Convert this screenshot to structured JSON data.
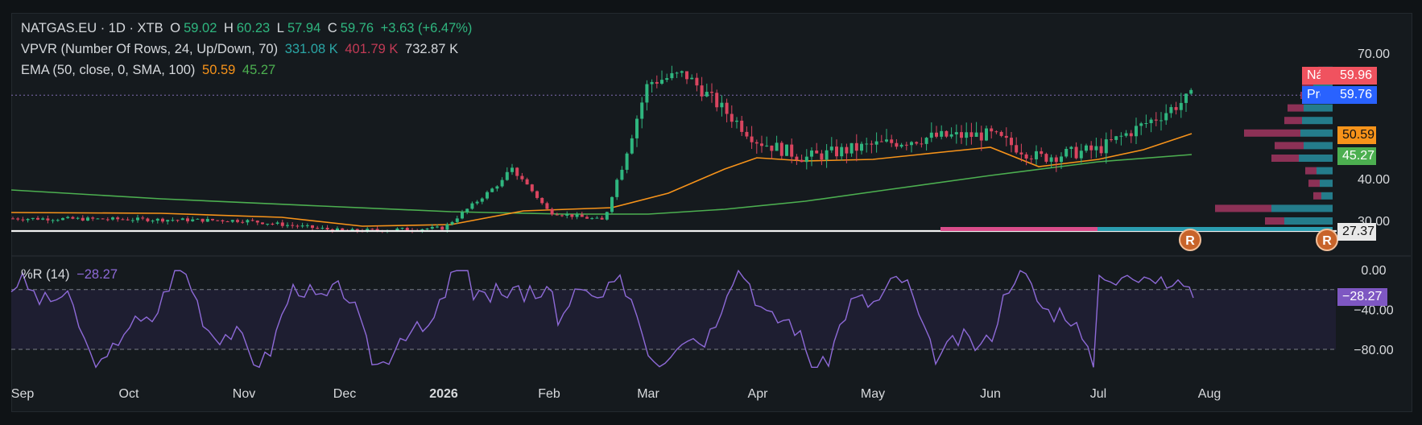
{
  "header": {
    "symbol": "NATGAS.EU · 1D · XTB",
    "o_label": "O",
    "o_value": "59.02",
    "h_label": "H",
    "h_value": "60.23",
    "l_label": "L",
    "l_value": "57.94",
    "c_label": "C",
    "c_value": "59.76",
    "change": "+3.63 (+6.47%)"
  },
  "vpvr": {
    "label": "VPVR (Number Of Rows, 24, Up/Down, 70)",
    "up": "331.08 K",
    "down": "401.79 K",
    "total": "732.87 K"
  },
  "ema": {
    "label": "EMA (50, close, 0, SMA, 100)",
    "v1": "50.59",
    "v2": "45.27"
  },
  "wr": {
    "label": "%R (14)",
    "value": "−28.27"
  },
  "badges": {
    "buy_label": "Nákup",
    "buy_value": "59.96",
    "sell_label": "Prodej",
    "sell_value": "59.76",
    "ema50": "50.59",
    "ema100": "45.27",
    "hline": "27.37",
    "wr": "−28.27"
  },
  "colors": {
    "up": "#2fb67f",
    "down": "#d9455f",
    "ema50": "#f7931a",
    "ema100": "#4caf50",
    "wr": "#8e6ad8",
    "buy": "#f0525f",
    "sell": "#2962ff"
  },
  "chart_data": [
    {
      "type": "candlestick",
      "x_tick_labels": [
        "Sep",
        "Oct",
        "Nov",
        "Dec",
        "2026",
        "Feb",
        "Mar",
        "Apr",
        "May",
        "Jun",
        "Jul",
        "Aug"
      ],
      "y_tick_labels": [
        "70.00",
        "40.00",
        "30.00"
      ],
      "ylim": [
        25,
        78
      ],
      "close_trend": [
        {
          "x": "Sep",
          "y": 30.5
        },
        {
          "x": "Oct",
          "y": 30.3
        },
        {
          "x": "Nov",
          "y": 30.0
        },
        {
          "x": "Dec",
          "y": 27.5
        },
        {
          "x": "2026",
          "y": 28.2
        },
        {
          "x": "mid-Jan",
          "y": 42.0
        },
        {
          "x": "Feb",
          "y": 32.0
        },
        {
          "x": "late-Feb",
          "y": 30.0
        },
        {
          "x": "Mar",
          "y": 63.0
        },
        {
          "x": "mid-Mar",
          "y": 65.0
        },
        {
          "x": "Apr",
          "y": 49.0
        },
        {
          "x": "mid-Apr",
          "y": 45.0
        },
        {
          "x": "May",
          "y": 48.0
        },
        {
          "x": "mid-May",
          "y": 50.0
        },
        {
          "x": "Jun",
          "y": 50.5
        },
        {
          "x": "mid-Jun",
          "y": 45.0
        },
        {
          "x": "Jul",
          "y": 47.0
        },
        {
          "x": "mid-Jul",
          "y": 55.0
        },
        {
          "x": "late-Jul",
          "y": 59.76
        }
      ],
      "series": [
        {
          "name": "EMA 50",
          "last": 50.59
        },
        {
          "name": "EMA 100",
          "last": 45.27
        }
      ],
      "horizontal_line": 27.37,
      "current_price_line": 59.96
    },
    {
      "type": "line",
      "name": "%R (14)",
      "y_tick_labels": [
        "0.00",
        "−40.00",
        "−80.00"
      ],
      "ylim": [
        -100,
        0
      ],
      "bands": [
        -20,
        -80
      ],
      "last": -28.27
    }
  ],
  "vpvr_rows": [
    {
      "price": 66,
      "up": 12,
      "down": 6
    },
    {
      "price": 63,
      "up": 24,
      "down": 14
    },
    {
      "price": 60,
      "up": 30,
      "down": 10
    },
    {
      "price": 57,
      "up": 36,
      "down": 20
    },
    {
      "price": 54,
      "up": 38,
      "down": 22
    },
    {
      "price": 51,
      "up": 40,
      "down": 70
    },
    {
      "price": 48,
      "up": 36,
      "down": 36
    },
    {
      "price": 45,
      "up": 42,
      "down": 34
    },
    {
      "price": 42,
      "up": 20,
      "down": 14
    },
    {
      "price": 39,
      "up": 16,
      "down": 14
    },
    {
      "price": 36,
      "up": 14,
      "down": 10
    },
    {
      "price": 33,
      "up": 76,
      "down": 70
    },
    {
      "price": 30,
      "up": 60,
      "down": 24
    },
    {
      "price": 27.5,
      "up": 250,
      "down": 170
    }
  ]
}
